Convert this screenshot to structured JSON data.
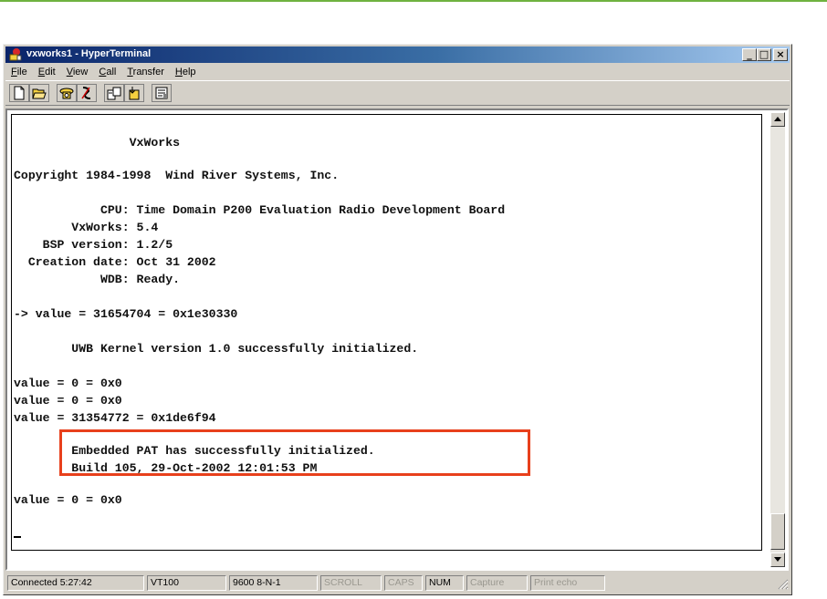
{
  "window": {
    "title": "vxworks1 - HyperTerminal",
    "controls": {
      "minimize": "_",
      "maximize": "□",
      "close": "×"
    }
  },
  "menu": [
    {
      "label": "File",
      "accel": "F",
      "rest": "ile"
    },
    {
      "label": "Edit",
      "accel": "E",
      "rest": "dit"
    },
    {
      "label": "View",
      "accel": "V",
      "rest": "iew"
    },
    {
      "label": "Call",
      "accel": "C",
      "rest": "all"
    },
    {
      "label": "Transfer",
      "accel": "T",
      "rest": "ransfer"
    },
    {
      "label": "Help",
      "accel": "H",
      "rest": "elp"
    }
  ],
  "toolbar": {
    "icons": [
      "new-connection-icon",
      "open-icon",
      "connect-icon",
      "disconnect-icon",
      "send-icon",
      "receive-icon",
      "properties-icon"
    ]
  },
  "terminal": {
    "lines": [
      "",
      "                VxWorks",
      "",
      "Copyright 1984-1998  Wind River Systems, Inc.",
      "",
      "            CPU: Time Domain P200 Evaluation Radio Development Board",
      "        VxWorks: 5.4",
      "    BSP version: 1.2/5",
      "  Creation date: Oct 31 2002",
      "            WDB: Ready.",
      "",
      "-> value = 31654704 = 0x1e30330",
      "",
      "        UWB Kernel version 1.0 successfully initialized.",
      "",
      "value = 0 = 0x0",
      "value = 0 = 0x0",
      "value = 31354772 = 0x1de6f94",
      "",
      "        Embedded PAT has successfully initialized.",
      "        Build 105, 29-Oct-2002 12:01:53 PM",
      "",
      "value = 0 = 0x0"
    ],
    "highlight_color": "#e8401c"
  },
  "status": {
    "connected": "Connected 5:27:42",
    "emulation": "VT100",
    "settings": "9600 8-N-1",
    "scroll": "SCROLL",
    "caps": "CAPS",
    "num": "NUM",
    "capture": "Capture",
    "print_echo": "Print echo"
  },
  "colors": {
    "title_start": "#0a246a",
    "title_end": "#a6caf0",
    "top_rule": "#6fb23f"
  }
}
